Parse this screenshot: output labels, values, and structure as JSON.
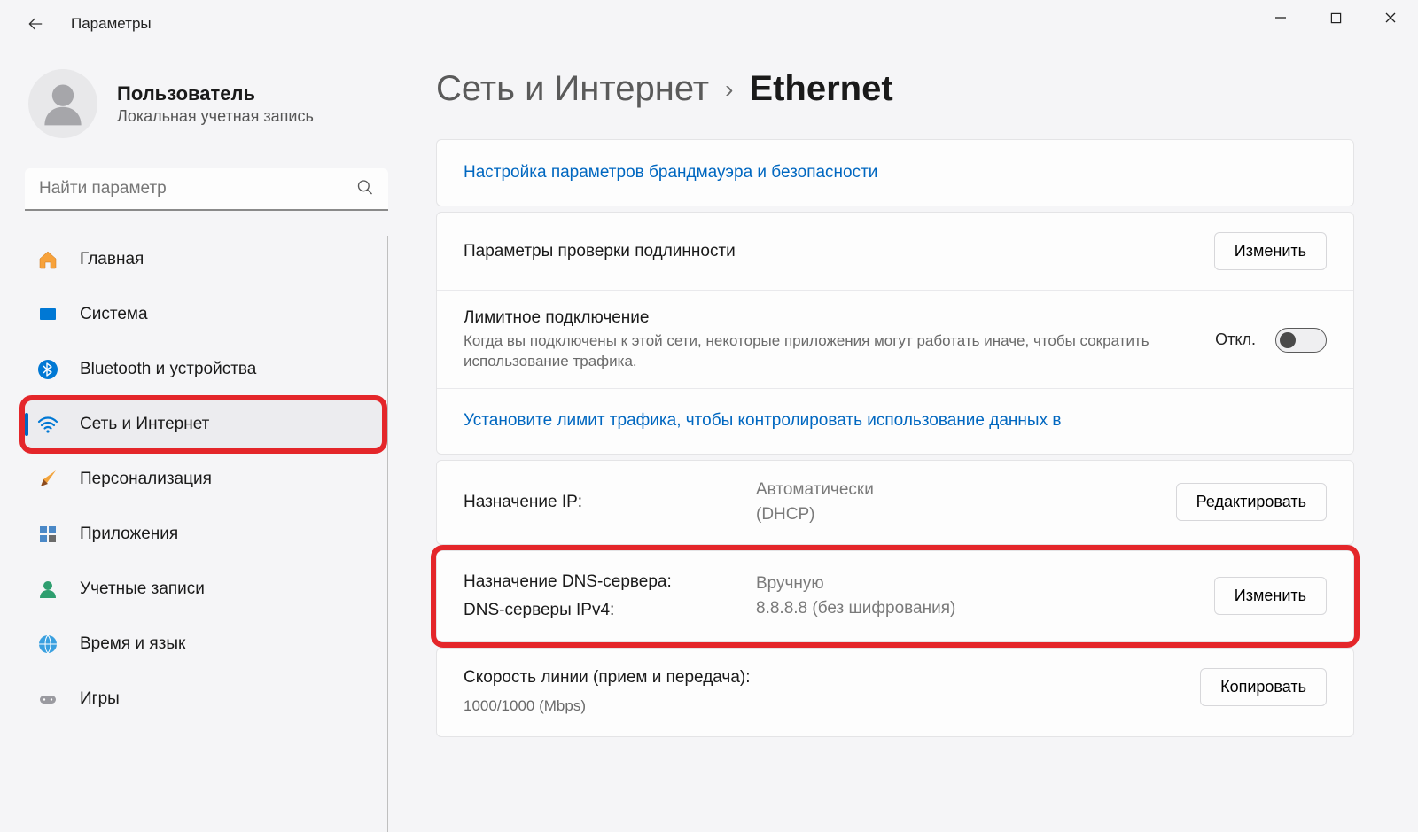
{
  "app": {
    "title": "Параметры"
  },
  "user": {
    "name": "Пользователь",
    "subtitle": "Локальная учетная запись"
  },
  "search": {
    "placeholder": "Найти параметр"
  },
  "nav": {
    "items": [
      {
        "label": "Главная"
      },
      {
        "label": "Система"
      },
      {
        "label": "Bluetooth и устройства"
      },
      {
        "label": "Сеть и Интернет"
      },
      {
        "label": "Персонализация"
      },
      {
        "label": "Приложения"
      },
      {
        "label": "Учетные записи"
      },
      {
        "label": "Время и язык"
      },
      {
        "label": "Игры"
      }
    ]
  },
  "breadcrumb": {
    "parent": "Сеть и Интернет",
    "current": "Ethernet"
  },
  "links": {
    "firewall": "Настройка параметров брандмауэра и безопасности",
    "limit": "Установите лимит трафика, чтобы контролировать использование данных в "
  },
  "auth": {
    "label": "Параметры проверки подлинности",
    "button": "Изменить"
  },
  "metered": {
    "title": "Лимитное подключение",
    "desc": "Когда вы подключены к этой сети, некоторые приложения могут работать иначе, чтобы сократить использование трафика.",
    "state": "Откл."
  },
  "ip": {
    "label": "Назначение IP:",
    "value_line1": "Автоматически",
    "value_line2": "(DHCP)",
    "button": "Редактировать"
  },
  "dns": {
    "label1": "Назначение DNS-сервера:",
    "label2": "DNS-серверы IPv4:",
    "value1": "Вручную",
    "value2": "8.8.8.8 (без шифрования)",
    "button": "Изменить"
  },
  "speed": {
    "label": "Скорость линии (прием и передача):",
    "value": "1000/1000 (Mbps)",
    "button": "Копировать"
  }
}
